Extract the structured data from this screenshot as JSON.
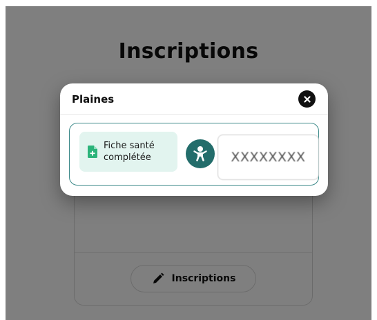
{
  "page": {
    "title": "Inscriptions",
    "card": {
      "inscriptions_button_label": "Inscriptions",
      "pencil_icon": "pencil-icon"
    }
  },
  "modal": {
    "title": "Plaines",
    "close_icon": "close-icon",
    "health_badge": {
      "icon": "document-plus-icon",
      "line1": "Fiche santé",
      "line2": "complétée",
      "background": "#e2f4ef",
      "icon_color": "#2bb37a"
    },
    "child_button": {
      "icon": "baby-icon",
      "color": "#236d6b"
    },
    "code_value": "XXXXXXXX",
    "border_color": "#3d8a8a"
  }
}
